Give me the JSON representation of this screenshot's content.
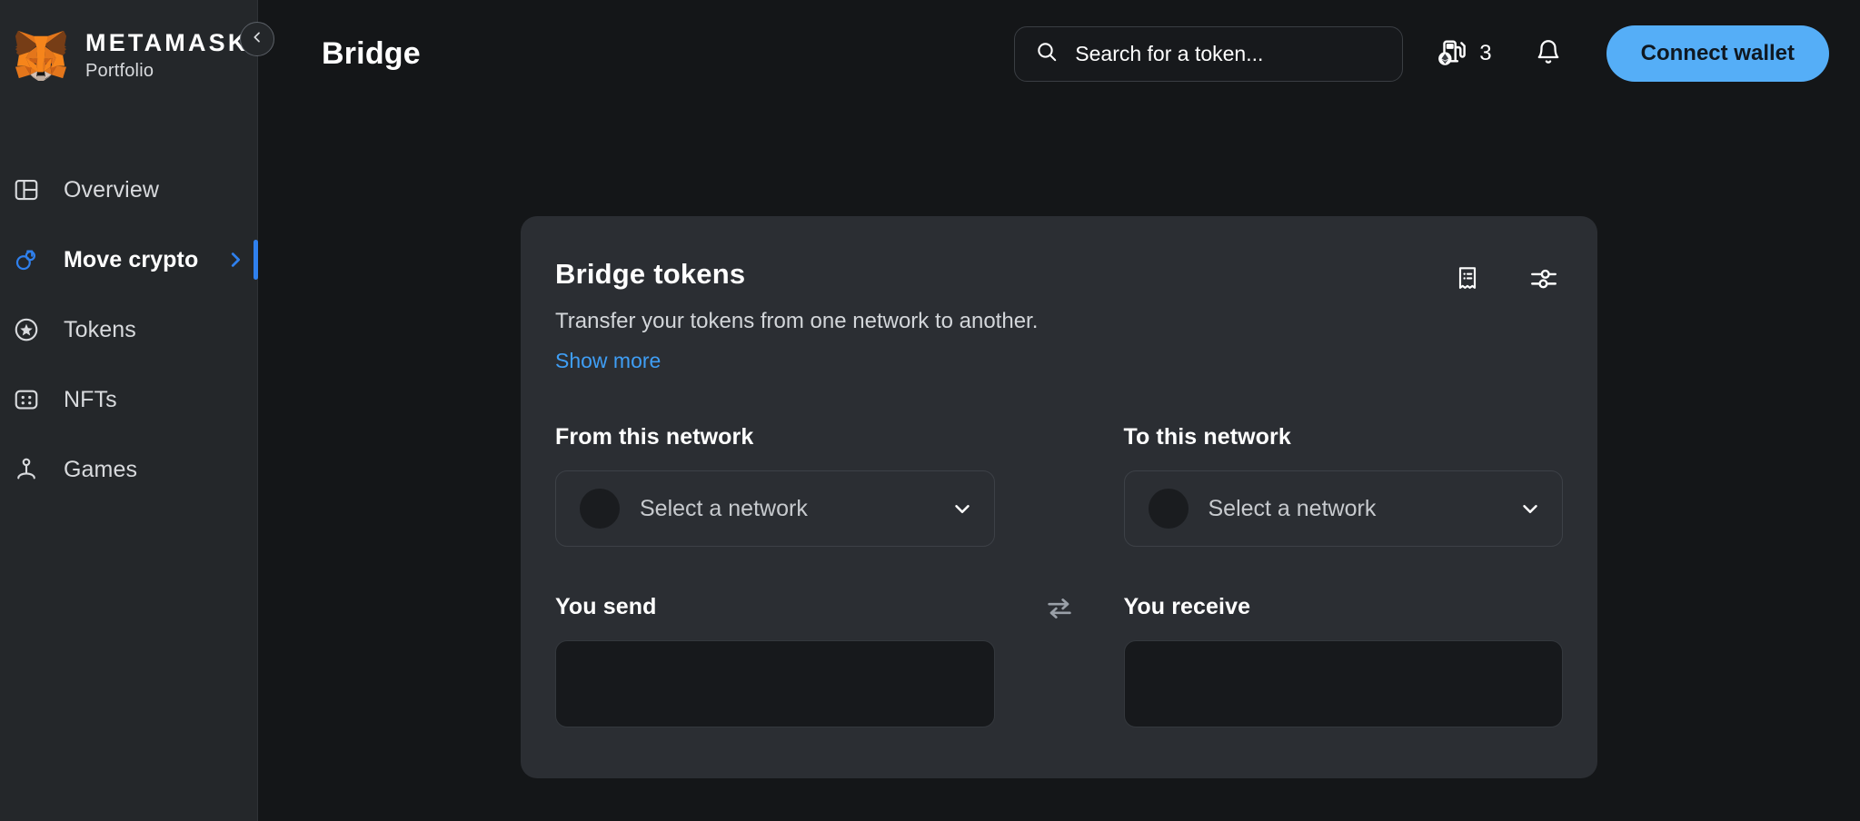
{
  "brand": {
    "title": "METAMASK",
    "subtitle": "Portfolio",
    "logo_icon": "metamask-fox-logo",
    "collapse_icon": "chevron-left-icon"
  },
  "sidebar": {
    "items": [
      {
        "label": "Overview",
        "icon": "layout-panel-icon",
        "active": false
      },
      {
        "label": "Move crypto",
        "icon": "move-crypto-icon",
        "active": true,
        "chevron_icon": "chevron-right-icon"
      },
      {
        "label": "Tokens",
        "icon": "star-circle-icon",
        "active": false
      },
      {
        "label": "NFTs",
        "icon": "nft-grid-icon",
        "active": false
      },
      {
        "label": "Games",
        "icon": "joystick-icon",
        "active": false
      }
    ]
  },
  "header": {
    "page_title": "Bridge",
    "search": {
      "placeholder": "Search for a token...",
      "value": "",
      "icon": "search-icon"
    },
    "gas": {
      "icon": "gas-pump-icon",
      "network_badge_icon": "ethereum-icon",
      "value": "3"
    },
    "notifications": {
      "icon": "bell-icon"
    },
    "connect_wallet_label": "Connect wallet"
  },
  "bridge_card": {
    "title": "Bridge tokens",
    "subtitle": "Transfer your tokens from one network to another.",
    "show_more_label": "Show more",
    "actions": [
      {
        "icon": "transaction-receipt-icon",
        "name": "activity-button"
      },
      {
        "icon": "settings-sliders-icon",
        "name": "settings-button"
      }
    ],
    "from_network": {
      "label": "From this network",
      "placeholder": "Select a network",
      "chevron_icon": "chevron-down-icon",
      "avatar_icon": "network-avatar-placeholder"
    },
    "to_network": {
      "label": "To this network",
      "placeholder": "Select a network",
      "chevron_icon": "chevron-down-icon",
      "avatar_icon": "network-avatar-placeholder"
    },
    "you_send": {
      "label": "You send",
      "value": ""
    },
    "you_receive": {
      "label": "You receive",
      "value": ""
    },
    "swap_icon": "swap-arrows-icon"
  },
  "colors": {
    "page_background": "#141618",
    "sidebar_background": "#24272a",
    "card_background": "#2b2e33",
    "accent_blue": "#3f9ef5",
    "button_blue": "#55aef7",
    "active_indicator": "#2f80ed",
    "input_background": "#17191c"
  }
}
